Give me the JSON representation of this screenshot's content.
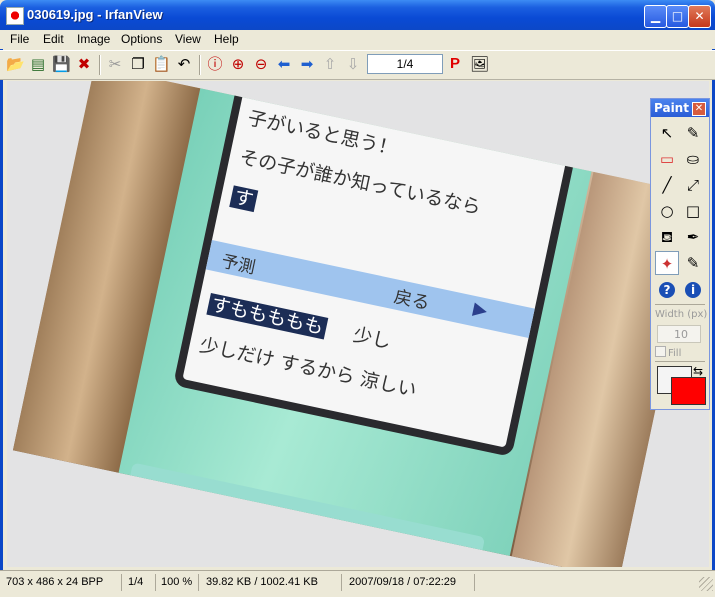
{
  "window": {
    "title": "030619.jpg - IrfanView",
    "min_glyph": "▁",
    "max_glyph": "□",
    "close_glyph": "✕"
  },
  "menu": [
    "File",
    "Edit",
    "Image",
    "Options",
    "View",
    "Help"
  ],
  "toolbar": {
    "page_indicator": "1/4",
    "icons": [
      "open-folder",
      "slideshow",
      "save",
      "delete",
      "cut",
      "copy",
      "paste",
      "undo",
      "info",
      "zoom-in",
      "zoom-out",
      "previous",
      "next",
      "first",
      "last",
      "print",
      "paint-plugin"
    ],
    "glyphs": {
      "open": "📂",
      "slideshow": "▤",
      "save": "💾",
      "delete": "✖",
      "cut": "✂",
      "copy": "❐",
      "paste": "📋",
      "undo": "↶",
      "info": "ⓘ",
      "zoom_in": "⊕",
      "zoom_out": "⊖",
      "prev": "⬅",
      "next": "➡",
      "first": "⇧",
      "last": "⇩",
      "print": "P",
      "paint": "🖼"
    }
  },
  "photo": {
    "line1": "子がいると思う！",
    "line2": "その子が誰か知っているなら",
    "line3": "す",
    "menu_left": "予測",
    "menu_right": "戻る",
    "menu_arrow": "▶",
    "input_highlight": "すももももも",
    "input_right": "少し",
    "line_bottom": "少しだけ するから 涼しい"
  },
  "paint_panel": {
    "title": "Paint",
    "close": "✕",
    "tool_glyphs": [
      "↖",
      "✎",
      "▭",
      "⛀",
      "╱",
      "⤢",
      "○",
      "□",
      "⛾",
      "✒",
      "✦",
      "✎",
      "?",
      "i"
    ],
    "width_label": "Width (px)",
    "width_value": "10",
    "fill_label": "Fill",
    "swap": "⇆",
    "primary_color": "#ff0000",
    "secondary_color": "#f4f4f4"
  },
  "statusbar": {
    "dimensions": "703 x 486 x 24 BPP",
    "page": "1/4",
    "zoom": "100 %",
    "size": "39.82 KB / 1002.41 KB",
    "datetime": "2007/09/18 / 07:22:29"
  }
}
